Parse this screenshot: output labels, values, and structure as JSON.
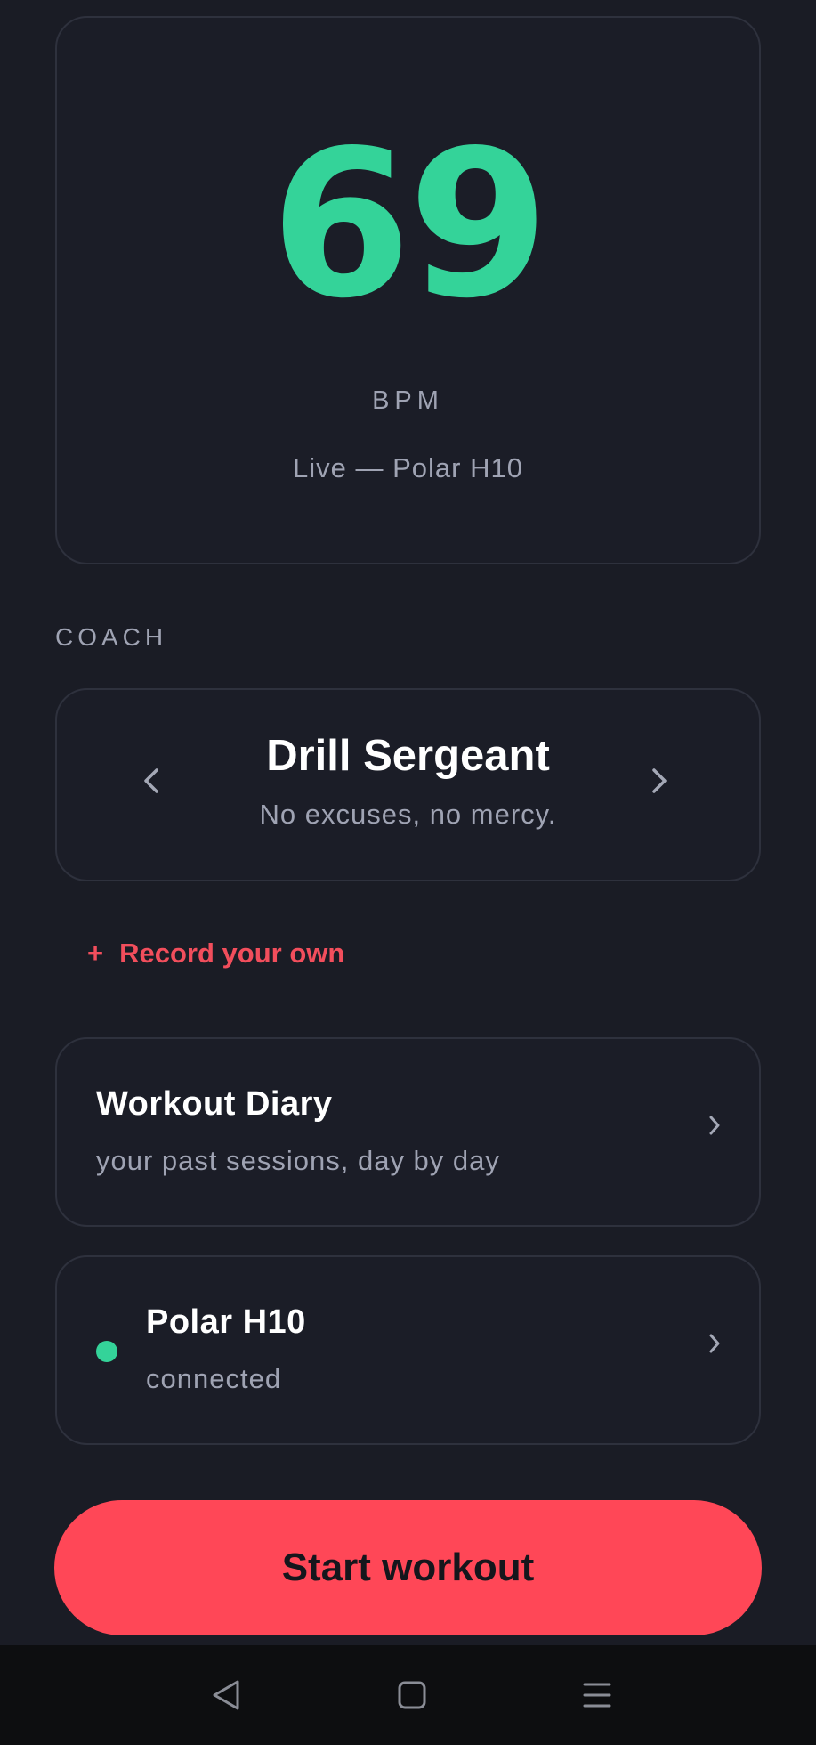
{
  "heart_rate": {
    "value": "69",
    "unit": "BPM",
    "source": "Live — Polar H10"
  },
  "coach": {
    "section_label": "COACH",
    "name": "Drill Sergeant",
    "tagline": "No excuses, no mercy.",
    "prev_icon": "chevron-left-icon",
    "next_icon": "chevron-right-icon"
  },
  "record": {
    "plus": "+",
    "label": "Record your own"
  },
  "diary": {
    "title": "Workout Diary",
    "subtitle": "your past sessions, day by day"
  },
  "device": {
    "name": "Polar H10",
    "status": "connected",
    "status_color": "#34d399"
  },
  "start_button": {
    "label": "Start workout"
  },
  "colors": {
    "background": "#1a1c25",
    "accent_green": "#34d399",
    "accent_red": "#ff4757"
  },
  "nav": {
    "back_icon": "back-triangle-icon",
    "home_icon": "home-square-icon",
    "menu_icon": "menu-lines-icon"
  }
}
